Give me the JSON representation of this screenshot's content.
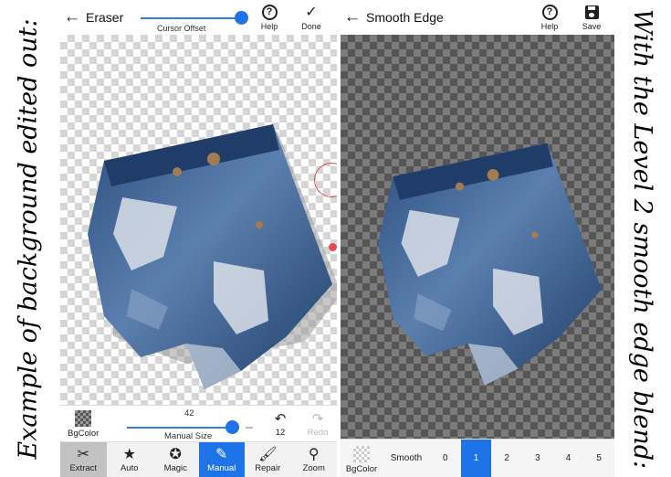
{
  "captions": {
    "left": "Example of background edited out:",
    "right": "With the Level 2 smooth edge blend:"
  },
  "eraser_screen": {
    "title": "Eraser",
    "cursor_offset_label": "Cursor Offset",
    "help_label": "Help",
    "done_label": "Done",
    "brush_size_value": "42",
    "size_label": "Manual Size",
    "bgcolor_label": "BgColor",
    "undo_count": "12",
    "redo_label": "Redo",
    "tools": [
      {
        "label": "Extract",
        "icon": "scissors-icon"
      },
      {
        "label": "Auto",
        "icon": "star-icon"
      },
      {
        "label": "Magic",
        "icon": "magic-star-icon"
      },
      {
        "label": "Manual",
        "icon": "eraser-icon"
      },
      {
        "label": "Repair",
        "icon": "brush-icon"
      },
      {
        "label": "Zoom",
        "icon": "search-icon"
      }
    ],
    "selected_tool": "Manual"
  },
  "smooth_screen": {
    "title": "Smooth Edge",
    "help_label": "Help",
    "save_label": "Save",
    "bgcolor_label": "BgColor",
    "smooth_label": "Smooth",
    "levels": [
      "0",
      "1",
      "2",
      "3",
      "4",
      "5"
    ],
    "selected_level": "1"
  },
  "colors": {
    "accent": "#1e73e8",
    "cursor_marker": "#e5484d"
  }
}
